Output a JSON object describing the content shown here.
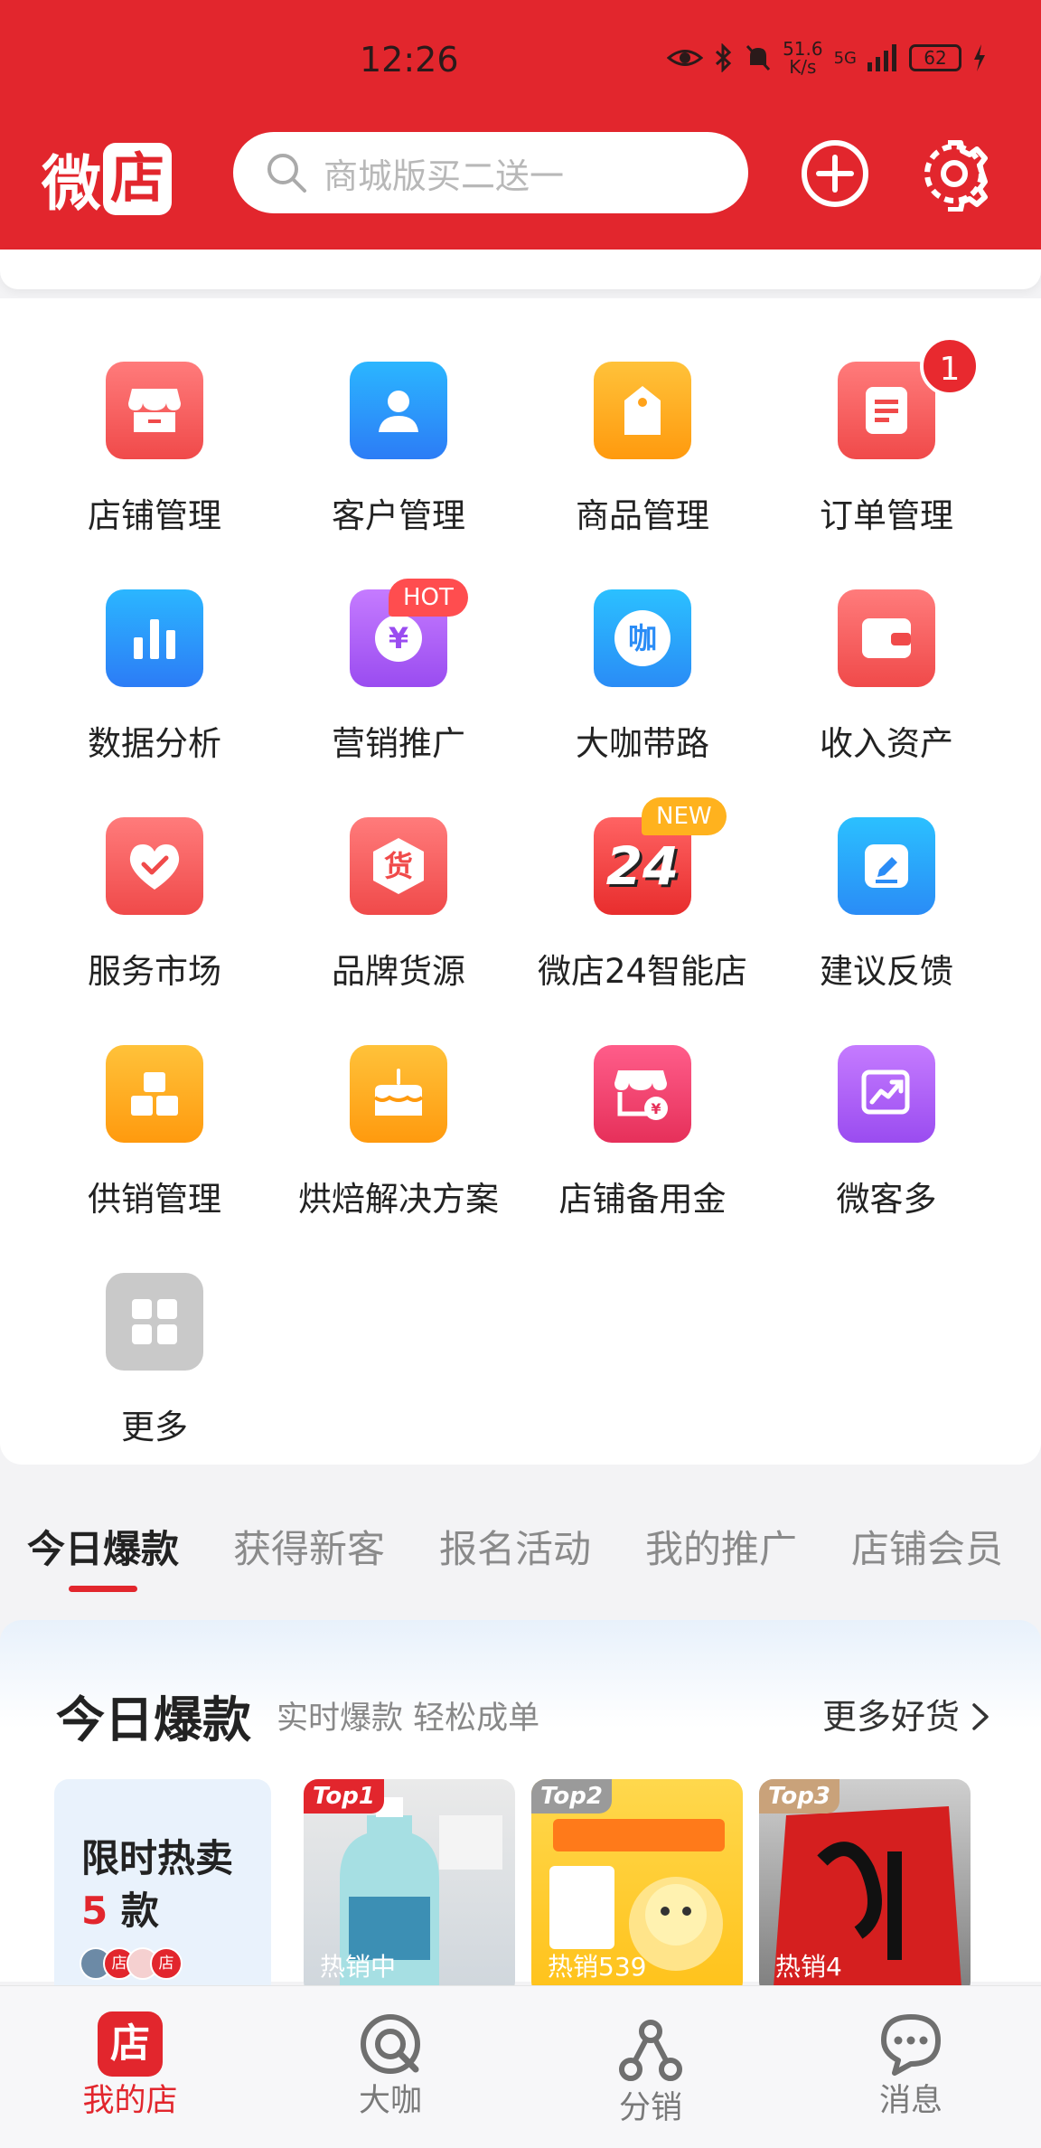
{
  "status_bar": {
    "time": "12:26",
    "net_speed_value": "51.6",
    "net_speed_unit": "K/s",
    "network": "5G",
    "battery": "62"
  },
  "header": {
    "logo_wei": "微",
    "logo_dian": "店",
    "search_placeholder": "商城版买二送一",
    "bg_color": "#e2262d"
  },
  "grid": {
    "items": [
      {
        "label": "店铺管理",
        "icon": "store-icon"
      },
      {
        "label": "客户管理",
        "icon": "user-icon"
      },
      {
        "label": "商品管理",
        "icon": "tag-icon"
      },
      {
        "label": "订单管理",
        "icon": "document-icon",
        "badge": "1"
      },
      {
        "label": "数据分析",
        "icon": "bar-chart-icon"
      },
      {
        "label": "营销推广",
        "icon": "yen-icon",
        "tag": "HOT"
      },
      {
        "label": "大咖带路",
        "icon": "chat-bubble-icon",
        "glyph": "咖"
      },
      {
        "label": "收入资产",
        "icon": "wallet-icon"
      },
      {
        "label": "服务市场",
        "icon": "heart-icon"
      },
      {
        "label": "品牌货源",
        "icon": "hexagon-icon",
        "glyph": "货"
      },
      {
        "label": "微店24智能店",
        "icon": "24-icon",
        "glyph": "24",
        "tag": "NEW"
      },
      {
        "label": "建议反馈",
        "icon": "pen-icon"
      },
      {
        "label": "供销管理",
        "icon": "boxes-icon"
      },
      {
        "label": "烘焙解决方案",
        "icon": "cake-icon"
      },
      {
        "label": "店铺备用金",
        "icon": "store-yen-icon"
      },
      {
        "label": "微客多",
        "icon": "trend-icon"
      },
      {
        "label": "更多",
        "icon": "more-grid-icon"
      }
    ]
  },
  "tabs": [
    "今日爆款",
    "获得新客",
    "报名活动",
    "我的推广",
    "店铺会员"
  ],
  "hot": {
    "title": "今日爆款",
    "subtitle": "实时爆款 轻松成单",
    "more": "更多好货",
    "promo_title": "限时热卖",
    "promo_count": "5",
    "promo_unit": " 款",
    "avatar_label": "店",
    "products": [
      {
        "rank": "Top1",
        "caption": "热销中"
      },
      {
        "rank": "Top2",
        "caption": "热销539"
      },
      {
        "rank": "Top3",
        "caption": "热销4"
      }
    ]
  },
  "nav": [
    {
      "label": "我的店",
      "icon": "store-icon",
      "glyph": "店"
    },
    {
      "label": "大咖",
      "icon": "daka-icon"
    },
    {
      "label": "分销",
      "icon": "share-icon"
    },
    {
      "label": "消息",
      "icon": "message-icon"
    }
  ]
}
